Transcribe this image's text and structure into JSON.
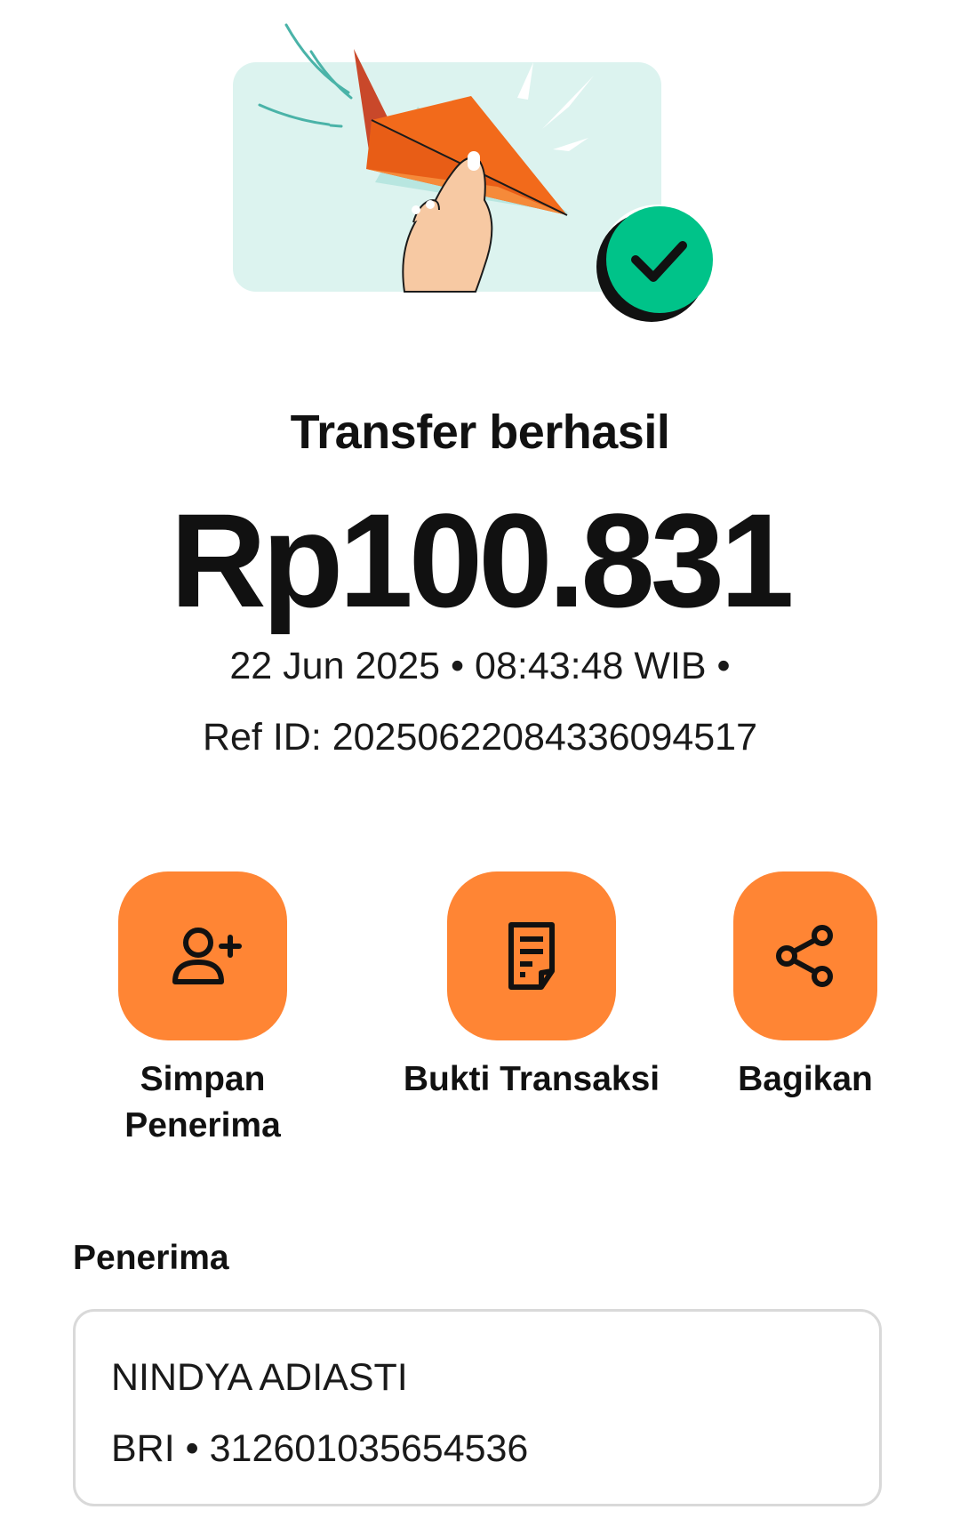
{
  "status": {
    "title": "Transfer berhasil",
    "amount": "Rp100.831",
    "datetime_line": "22 Jun 2025 • 08:43:48 WIB •",
    "ref_line": "Ref ID: 20250622084336094517"
  },
  "actions": [
    {
      "label": "Simpan Penerima",
      "icon": "add-person-icon"
    },
    {
      "label": "Bukti Transaksi",
      "icon": "receipt-icon"
    },
    {
      "label": "Bagikan",
      "icon": "share-icon"
    }
  ],
  "recipient": {
    "section_label": "Penerima",
    "name": "NINDYA ADIASTI",
    "bank_account": "BRI • 312601035654536"
  },
  "colors": {
    "accent": "#ff8534",
    "success": "#00c389",
    "illustration_bg": "#dcf3ef"
  }
}
